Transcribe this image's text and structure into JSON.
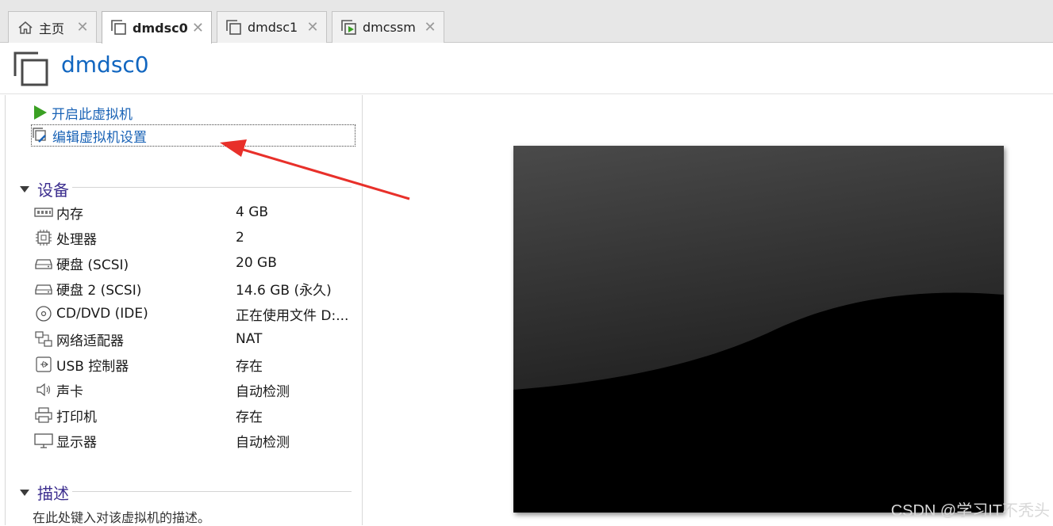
{
  "tabs": [
    {
      "label": "主页",
      "icon": "home-icon",
      "active": false
    },
    {
      "label": "dmdsc0",
      "icon": "vm-icon",
      "active": true
    },
    {
      "label": "dmdsc1",
      "icon": "vm-icon",
      "active": false
    },
    {
      "label": "dmcssm",
      "icon": "vm-running-icon",
      "active": false
    }
  ],
  "header": {
    "title": "dmdsc0"
  },
  "actions": {
    "power_on": "开启此虚拟机",
    "edit_settings": "编辑虚拟机设置"
  },
  "devices": {
    "heading": "设备",
    "items": [
      {
        "name": "内存",
        "value": "4 GB",
        "icon": "memory-icon"
      },
      {
        "name": "处理器",
        "value": "2",
        "icon": "cpu-icon"
      },
      {
        "name": "硬盘 (SCSI)",
        "value": "20 GB",
        "icon": "hard-disk-icon"
      },
      {
        "name": "硬盘 2 (SCSI)",
        "value": "14.6 GB (永久)",
        "icon": "hard-disk-icon"
      },
      {
        "name": "CD/DVD (IDE)",
        "value": "正在使用文件 D:...",
        "icon": "cd-dvd-icon"
      },
      {
        "name": "网络适配器",
        "value": "NAT",
        "icon": "network-adapter-icon"
      },
      {
        "name": "USB 控制器",
        "value": "存在",
        "icon": "usb-icon"
      },
      {
        "name": "声卡",
        "value": "自动检测",
        "icon": "sound-card-icon"
      },
      {
        "name": "打印机",
        "value": "存在",
        "icon": "printer-icon"
      },
      {
        "name": "显示器",
        "value": "自动检测",
        "icon": "display-icon"
      }
    ]
  },
  "description": {
    "heading": "描述",
    "placeholder": "在此处键入对该虚拟机的描述。"
  },
  "watermark": "CSDN @学习IT不秃头",
  "colors": {
    "link_blue": "#1a63b6",
    "title_blue": "#1166c0",
    "section_purple": "#3d2f8f",
    "play_green": "#3aa023",
    "annotation_red": "#e8302a"
  }
}
